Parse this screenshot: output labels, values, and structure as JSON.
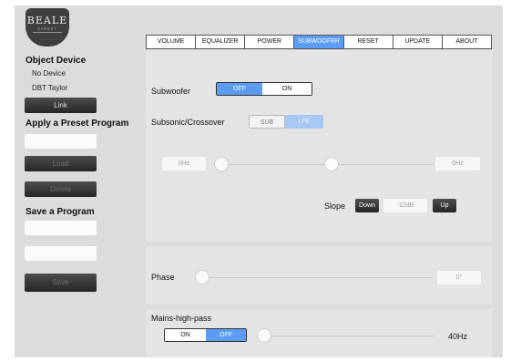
{
  "logo": {
    "text": "BEALE",
    "subtext": "STREET"
  },
  "sidebar": {
    "object_device_title": "Object Device",
    "devices": [
      "No Device",
      "DBT Taylor"
    ],
    "link_label": "Link",
    "preset_title": "Apply a Preset Program",
    "preset_value": "",
    "load_label": "Load",
    "delete_label": "Delete",
    "save_program_title": "Save a Program",
    "save_name_value": "",
    "save_field2_value": "",
    "save_label": "Save"
  },
  "tabs": [
    {
      "label": "VOLUME"
    },
    {
      "label": "EQUALIZER"
    },
    {
      "label": "POWER"
    },
    {
      "label": "SUBWOOFER",
      "active": true
    },
    {
      "label": "RESET"
    },
    {
      "label": "UPDATE"
    },
    {
      "label": "ABOUT"
    }
  ],
  "subwoofer": {
    "label": "Subwoofer",
    "off_label": "OFF",
    "on_label": "ON",
    "selected": "OFF",
    "crossover_label": "Subsonic/Crossover",
    "sub_label": "SUB",
    "lfe_label": "LFE",
    "crossover_selected": "LFE",
    "low_value": "0Hz",
    "high_value": "0Hz",
    "slope_label": "Slope",
    "down_label": "Down",
    "slope_value": "-12dB",
    "up_label": "Up"
  },
  "phase": {
    "label": "Phase",
    "value": "0°",
    "level": 0
  },
  "mains": {
    "label": "Mains-high-pass",
    "on_label": "ON",
    "off_label": "OFF",
    "selected": "OFF",
    "value": "40Hz"
  },
  "colors": {
    "accent": "#5b9cf6",
    "panel": "#e4e4e4",
    "background": "#dcdcdc",
    "dark_button": "#2f2f2f"
  }
}
